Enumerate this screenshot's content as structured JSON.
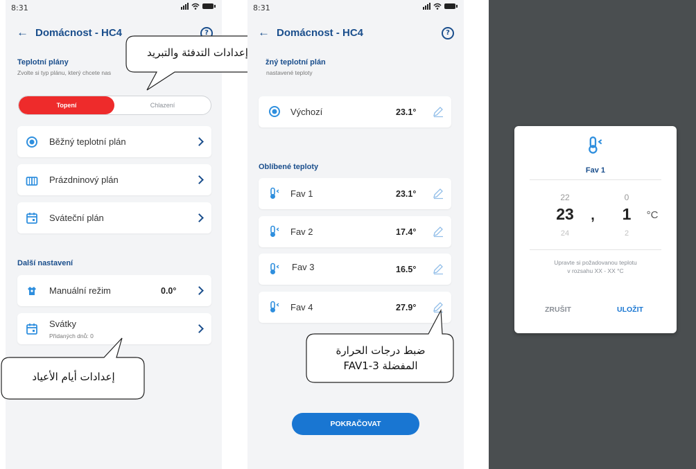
{
  "colors": {
    "accent": "#1a4e8c",
    "heating": "#ee2b2b",
    "button": "#1976d2",
    "overlay": "#4a4e50"
  },
  "screen1": {
    "time": "8:31",
    "title": "Domácnost - HC4",
    "section_title": "Teplotní plány",
    "section_subtitle": "Zvolte si typ plánu, který chcete nas",
    "toggle": {
      "active": "Topení",
      "inactive": "Chlazení"
    },
    "plans": [
      {
        "label": "Běžný teplotní plán",
        "icon": "target-icon"
      },
      {
        "label": "Prázdninový plán",
        "icon": "gift-icon"
      },
      {
        "label": "Sváteční plán",
        "icon": "calendar-icon"
      }
    ],
    "more_title": "Další nastavení",
    "manual": {
      "label": "Manuální režim",
      "value": "0.0°"
    },
    "holidays": {
      "label": "Svátky",
      "sublabel": "Přidaných dnů: 0"
    },
    "bubble_top": "إعدادات التدفئة والتبريد",
    "bubble_bottom": "إعدادات أيام الأعياد"
  },
  "screen2": {
    "time": "8:31",
    "title": "Domácnost - HC4",
    "section_title": "žný teplotní plán",
    "section_subtitle": "nastavené teploty",
    "default": {
      "label": "Výchozí",
      "value": "23.1°"
    },
    "fav_title": "Oblíbené teploty",
    "favs": [
      {
        "label": "Fav 1",
        "value": "23.1°"
      },
      {
        "label": "Fav 2",
        "value": "17.4°"
      },
      {
        "label": "Fav 3",
        "value": "16.5°"
      },
      {
        "label": "Fav 4",
        "value": "27.9°"
      }
    ],
    "bubble_line1": "ضبط درجات الحرارة",
    "bubble_line2": "المفضلة FAV1-3",
    "continue": "POKRAČOVAT"
  },
  "screen3": {
    "dialog_title": "Fav 1",
    "int_prev": "22",
    "int_value": "23",
    "int_next": "24",
    "separator": ",",
    "dec_prev": "0",
    "dec_value": "1",
    "dec_next": "2",
    "unit": "°C",
    "hint_line1": "Upravte si požadovanou teplotu",
    "hint_line2": "v rozsahu XX - XX °C",
    "cancel": "ZRUŠIT",
    "save": "ULOŽIT"
  }
}
